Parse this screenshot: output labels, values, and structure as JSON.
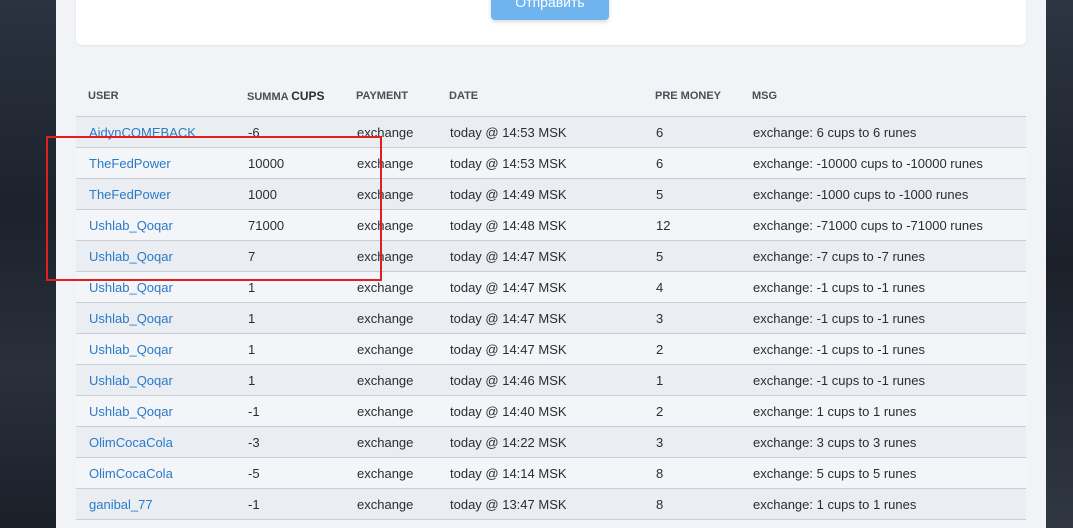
{
  "form": {
    "submit_label": "Отправить"
  },
  "table": {
    "headers": {
      "user": "USER",
      "summa": "SUMMA",
      "cups": "CUPS",
      "payment": "PAYMENT",
      "date": "DATE",
      "pre_money": "PRE MONEY",
      "msg": "MSG"
    },
    "rows": [
      {
        "user": "AidynCOMEBACK",
        "summa": "-6",
        "payment": "exchange",
        "date": "today @ 14:53 MSK",
        "pre_money": "6",
        "msg": "exchange: 6 cups to 6 runes"
      },
      {
        "user": "TheFedPower",
        "summa": "10000",
        "payment": "exchange",
        "date": "today @ 14:53 MSK",
        "pre_money": "6",
        "msg": "exchange: -10000 cups to -10000 runes"
      },
      {
        "user": "TheFedPower",
        "summa": "1000",
        "payment": "exchange",
        "date": "today @ 14:49 MSK",
        "pre_money": "5",
        "msg": "exchange: -1000 cups to -1000 runes"
      },
      {
        "user": "Ushlab_Qoqar",
        "summa": "71000",
        "payment": "exchange",
        "date": "today @ 14:48 MSK",
        "pre_money": "12",
        "msg": "exchange: -71000 cups to -71000 runes"
      },
      {
        "user": "Ushlab_Qoqar",
        "summa": "7",
        "payment": "exchange",
        "date": "today @ 14:47 MSK",
        "pre_money": "5",
        "msg": "exchange: -7 cups to -7 runes"
      },
      {
        "user": "Ushlab_Qoqar",
        "summa": "1",
        "payment": "exchange",
        "date": "today @ 14:47 MSK",
        "pre_money": "4",
        "msg": "exchange: -1 cups to -1 runes"
      },
      {
        "user": "Ushlab_Qoqar",
        "summa": "1",
        "payment": "exchange",
        "date": "today @ 14:47 MSK",
        "pre_money": "3",
        "msg": "exchange: -1 cups to -1 runes"
      },
      {
        "user": "Ushlab_Qoqar",
        "summa": "1",
        "payment": "exchange",
        "date": "today @ 14:47 MSK",
        "pre_money": "2",
        "msg": "exchange: -1 cups to -1 runes"
      },
      {
        "user": "Ushlab_Qoqar",
        "summa": "1",
        "payment": "exchange",
        "date": "today @ 14:46 MSK",
        "pre_money": "1",
        "msg": "exchange: -1 cups to -1 runes"
      },
      {
        "user": "Ushlab_Qoqar",
        "summa": "-1",
        "payment": "exchange",
        "date": "today @ 14:40 MSK",
        "pre_money": "2",
        "msg": "exchange: 1 cups to 1 runes"
      },
      {
        "user": "OlimCocaCola",
        "summa": "-3",
        "payment": "exchange",
        "date": "today @ 14:22 MSK",
        "pre_money": "3",
        "msg": "exchange: 3 cups to 3 runes"
      },
      {
        "user": "OlimCocaCola",
        "summa": "-5",
        "payment": "exchange",
        "date": "today @ 14:14 MSK",
        "pre_money": "8",
        "msg": "exchange: 5 cups to 5 runes"
      },
      {
        "user": "ganibal_77",
        "summa": "-1",
        "payment": "exchange",
        "date": "today @ 13:47 MSK",
        "pre_money": "8",
        "msg": "exchange: 1 cups to 1 runes"
      }
    ]
  },
  "colors": {
    "link": "#2a7bc7",
    "button": "#6fb4ef",
    "highlight": "#e01f1f"
  }
}
